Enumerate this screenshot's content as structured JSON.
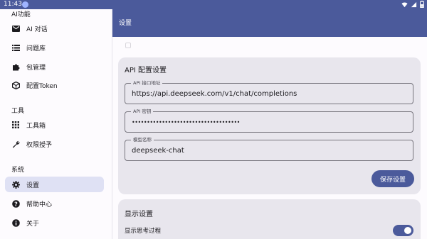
{
  "status_bar": {
    "time": "11:43"
  },
  "drawer": {
    "sections": [
      {
        "title": "AI功能",
        "items": [
          {
            "label": "AI 对话",
            "icon": "mail-icon"
          },
          {
            "label": "问题库",
            "icon": "list-icon"
          },
          {
            "label": "包管理",
            "icon": "puzzle-icon"
          },
          {
            "label": "配置Token",
            "icon": "cube-icon"
          }
        ]
      },
      {
        "title": "工具",
        "items": [
          {
            "label": "工具箱",
            "icon": "grid-icon"
          },
          {
            "label": "权限授予",
            "icon": "wrench-icon"
          }
        ]
      },
      {
        "title": "系统",
        "items": [
          {
            "label": "设置",
            "icon": "gear-icon",
            "active": true
          },
          {
            "label": "帮助中心",
            "icon": "help-icon"
          },
          {
            "label": "关于",
            "icon": "info-icon"
          }
        ]
      }
    ]
  },
  "appbar": {
    "title": "设置"
  },
  "api_card": {
    "title": "API 配置设置",
    "fields": [
      {
        "label": "API 接口地址",
        "value": "https://api.deepseek.com/v1/chat/completions"
      },
      {
        "label": "API 密钥",
        "value": "••••••••••••••••••••••••••••••••••••"
      },
      {
        "label": "模型名称",
        "value": "deepseek-chat"
      }
    ],
    "save_label": "保存设置"
  },
  "display_card": {
    "title": "显示设置",
    "toggle_label": "显示思考过程",
    "toggle_on": true
  },
  "colors": {
    "primary": "#4b5a9b",
    "card": "#e8e6ed",
    "active_nav": "#dfe1f4"
  }
}
